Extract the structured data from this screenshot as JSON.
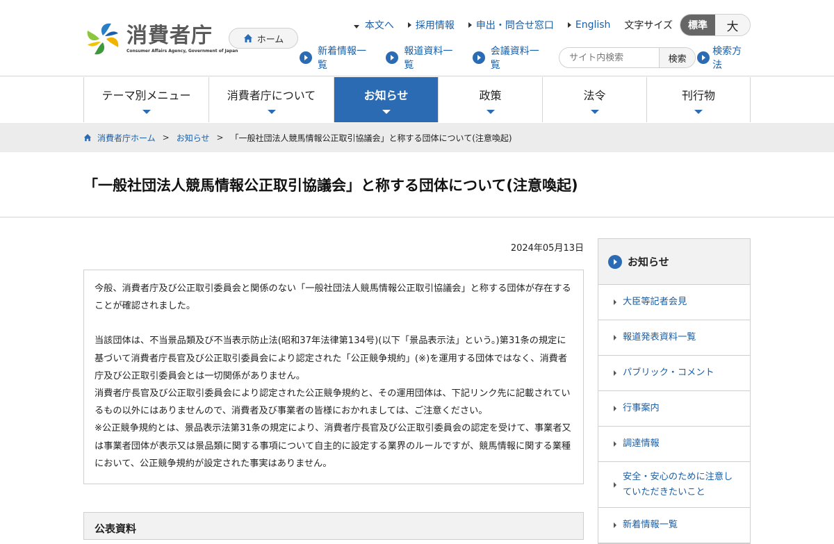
{
  "logo": {
    "jp": "消費者庁",
    "en": "Consumer Affairs Agency, Government of Japan"
  },
  "home_button": "ホーム",
  "util_links": {
    "main_text": "本文へ",
    "recruit": "採用情報",
    "contact": "申出・問合せ窓口",
    "english": "English"
  },
  "font_size": {
    "label": "文字サイズ",
    "standard": "標準",
    "large": "大"
  },
  "sub_links": {
    "news": "新着情報一覧",
    "press": "報道資料一覧",
    "meeting": "会議資料一覧"
  },
  "search": {
    "placeholder": "サイト内検索",
    "button": "検索",
    "help": "検索方法"
  },
  "gnav": [
    {
      "label": "テーマ別メニュー"
    },
    {
      "label": "消費者庁について"
    },
    {
      "label": "お知らせ"
    },
    {
      "label": "政策"
    },
    {
      "label": "法令"
    },
    {
      "label": "刊行物"
    }
  ],
  "breadcrumb": {
    "home": "消費者庁ホーム",
    "sep": ">",
    "notice": "お知らせ",
    "current": "「一般社団法人競馬情報公正取引協議会」と称する団体について(注意喚起)"
  },
  "page_title": "「一般社団法人競馬情報公正取引協議会」と称する団体について(注意喚起)",
  "date": "2024年05月13日",
  "notice": {
    "p1": "今般、消費者庁及び公正取引委員会と関係のない「一般社団法人競馬情報公正取引協議会」と称する団体が存在することが確認されました。",
    "p2": "当該団体は、不当景品類及び不当表示防止法(昭和37年法律第134号)(以下「景品表示法」という。)第31条の規定に基づいて消費者庁長官及び公正取引委員会により認定された「公正競争規約」(※)を運用する団体ではなく、消費者庁及び公正取引委員会とは一切関係がありません。",
    "p3": "消費者庁長官及び公正取引委員会により認定された公正競争規約と、その運用団体は、下記リンク先に記載されているもの以外にはありませんので、消費者及び事業者の皆様におかれましては、ご注意ください。",
    "p4": "※公正競争規約とは、景品表示法第31条の規定により、消費者庁長官及び公正取引委員会の認定を受けて、事業者又は事業者団体が表示又は景品類に関する事項について自主的に設定する業界のルールですが、競馬情報に関する業種において、公正競争規約が設定された事実はありません。"
  },
  "docs_heading": "公表資料",
  "side": {
    "heading": "お知らせ",
    "items": [
      "大臣等記者会見",
      "報道発表資料一覧",
      "パブリック・コメント",
      "行事案内",
      "調達情報",
      "安全・安心のために注意していただきたいこと",
      "新着情報一覧"
    ]
  },
  "colors": {
    "brand_blue": "#2a6bb4",
    "link": "#1a5fa8",
    "band_gray": "#ececec"
  }
}
